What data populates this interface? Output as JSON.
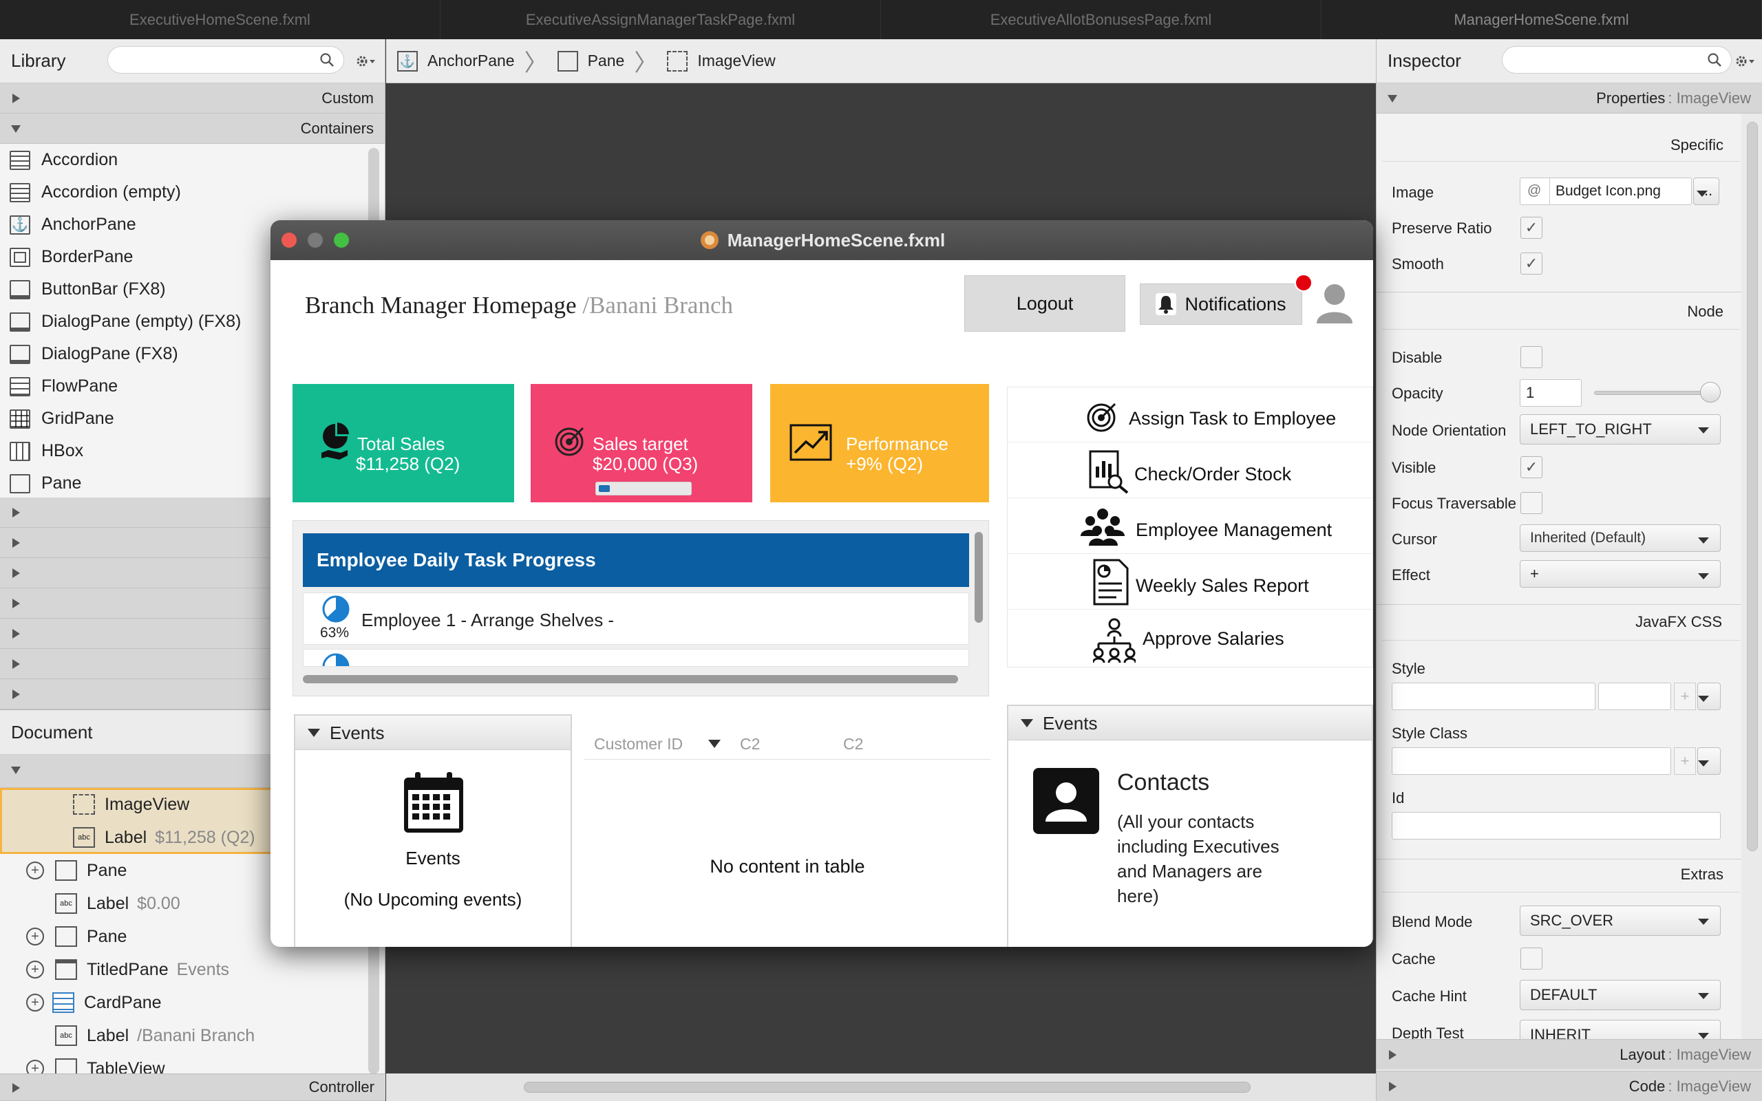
{
  "tabs": [
    "ExecutiveHomeScene.fxml",
    "ExecutiveAssignManagerTaskPage.fxml",
    "ExecutiveAllotBonusesPage.fxml",
    "ManagerHomeScene.fxml"
  ],
  "library": {
    "title": "Library",
    "sections": {
      "custom": "Custom",
      "containers": "Containers"
    },
    "items": [
      "Accordion",
      "Accordion  (empty)",
      "AnchorPane",
      "BorderPane",
      "ButtonBar  (FX8)",
      "DialogPane (empty)  (FX8)",
      "DialogPane  (FX8)",
      "FlowPane",
      "GridPane",
      "HBox",
      "Pane"
    ]
  },
  "document": {
    "title": "Document",
    "rows": [
      {
        "label": "ImageView",
        "extra": ""
      },
      {
        "label": "Label",
        "extra": "$11,258 (Q2)"
      },
      {
        "label": "Pane",
        "extra": ""
      },
      {
        "label": "Label",
        "extra": "$0.00"
      },
      {
        "label": "Pane",
        "extra": ""
      },
      {
        "label": "TitledPane",
        "extra": "Events"
      },
      {
        "label": "CardPane",
        "extra": ""
      },
      {
        "label": "Label",
        "extra": "/Banani Branch"
      },
      {
        "label": "TableView",
        "extra": ""
      }
    ],
    "controller": "Controller"
  },
  "breadcrumb": [
    "AnchorPane",
    "Pane",
    "ImageView"
  ],
  "inspector": {
    "title": "Inspector",
    "properties_label": "Properties",
    "properties_type": ": ImageView",
    "specific": "Specific",
    "image_label": "Image",
    "image_at": "@",
    "image_value": "Budget Icon.png",
    "browse": "...",
    "preserve_ratio": "Preserve Ratio",
    "smooth": "Smooth",
    "node": "Node",
    "disable": "Disable",
    "opacity": "Opacity",
    "opacity_value": "1",
    "node_orientation": "Node Orientation",
    "node_orientation_value": "LEFT_TO_RIGHT",
    "visible": "Visible",
    "focus_traversable": "Focus Traversable",
    "cursor": "Cursor",
    "cursor_value": "Inherited (Default)",
    "effect": "Effect",
    "effect_value": "+",
    "javafx_css": "JavaFX CSS",
    "style": "Style",
    "style_class": "Style Class",
    "id": "Id",
    "extras": "Extras",
    "blend_mode": "Blend Mode",
    "blend_mode_value": "SRC_OVER",
    "cache": "Cache",
    "cache_hint": "Cache Hint",
    "cache_hint_value": "DEFAULT",
    "depth_test": "Depth Test",
    "depth_test_value": "INHERIT",
    "layout_label": "Layout",
    "layout_type": ": ImageView",
    "code_label": "Code",
    "code_type": ": ImageView",
    "check_mark": "✓"
  },
  "window": {
    "title": "ManagerHomeScene.fxml",
    "heading": "Branch Manager Homepage ",
    "branch": "/Banani Branch",
    "logout": "Logout",
    "notifications": "Notifications",
    "cards": [
      {
        "line1": "Total Sales",
        "line2": "$11,258 (Q2)",
        "color": "#14bb91"
      },
      {
        "line1": "Sales target",
        "line2": "$20,000 (Q3)",
        "color": "#f2426f",
        "progress": 0.12
      },
      {
        "line1": "Performance",
        "line2": "+9% (Q2)",
        "color": "#fbb52f"
      }
    ],
    "actions": [
      "Assign Task to Employee",
      "Check/Order Stock",
      "Employee Management",
      "Weekly Sales Report",
      "Approve Salaries"
    ],
    "task_progress": {
      "title": "Employee Daily Task Progress",
      "items": [
        {
          "percent": "63%",
          "text": "Employee 1 - Arrange Shelves -",
          "fraction": 0.63
        }
      ],
      "title_color": "#0b5ea1"
    },
    "events_left": {
      "header": "Events",
      "label": "Events",
      "sub": "(No Upcoming events)"
    },
    "table": {
      "columns": [
        "Customer ID",
        "C2",
        "C2"
      ],
      "empty": "No content in table"
    },
    "events_right": {
      "header": "Events",
      "title": "Contacts",
      "text": "(All your contacts including Executives and Managers are here)"
    }
  }
}
